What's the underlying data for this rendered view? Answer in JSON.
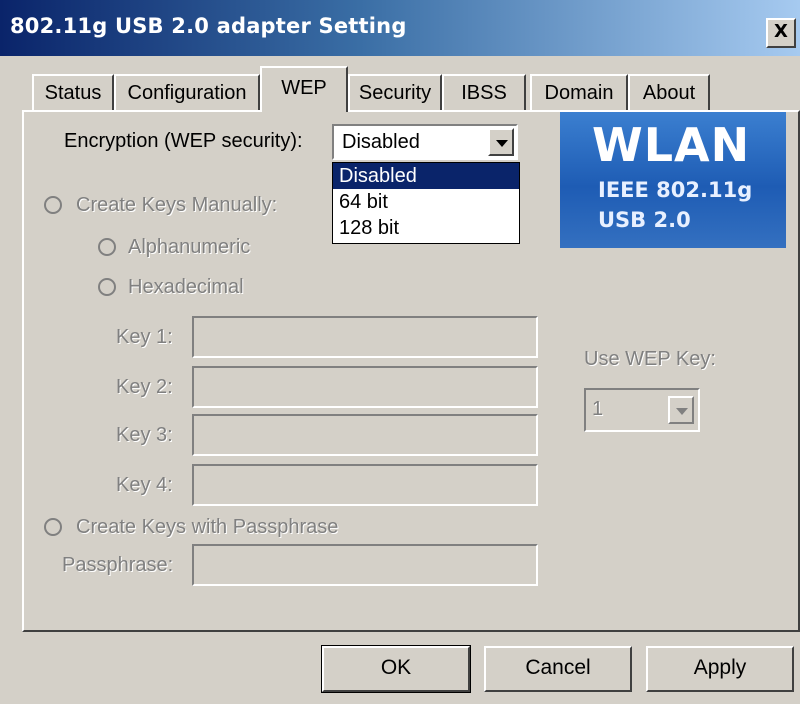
{
  "window": {
    "title": "802.11g USB 2.0 adapter Setting",
    "close_label": "X"
  },
  "tabs": [
    {
      "label": "Status"
    },
    {
      "label": "Configuration"
    },
    {
      "label": "WEP"
    },
    {
      "label": "Security"
    },
    {
      "label": "IBSS"
    },
    {
      "label": "Domain"
    },
    {
      "label": "About"
    }
  ],
  "active_tab": "WEP",
  "encryption": {
    "label": "Encryption (WEP security):",
    "value": "Disabled",
    "options": [
      "Disabled",
      "64 bit",
      "128 bit"
    ]
  },
  "banner": {
    "title": "WLAN",
    "line1": "IEEE 802.11g",
    "line2": "USB 2.0"
  },
  "manual": {
    "label": "Create Keys Manually:",
    "alphanumeric": "Alphanumeric",
    "hexadecimal": "Hexadecimal"
  },
  "keys": [
    {
      "label": "Key 1:",
      "value": ""
    },
    {
      "label": "Key 2:",
      "value": ""
    },
    {
      "label": "Key 3:",
      "value": ""
    },
    {
      "label": "Key 4:",
      "value": ""
    }
  ],
  "use_key": {
    "label": "Use WEP Key:",
    "value": "1"
  },
  "passphrase": {
    "radio_label": "Create Keys with Passphrase",
    "label": "Passphrase:",
    "value": ""
  },
  "buttons": {
    "ok": "OK",
    "cancel": "Cancel",
    "apply": "Apply"
  },
  "colors": {
    "face": "#d4d0c8",
    "selection": "#0a246a",
    "title_start": "#0a246a",
    "disabled_text": "#808080",
    "banner": "#1e5cb4"
  }
}
